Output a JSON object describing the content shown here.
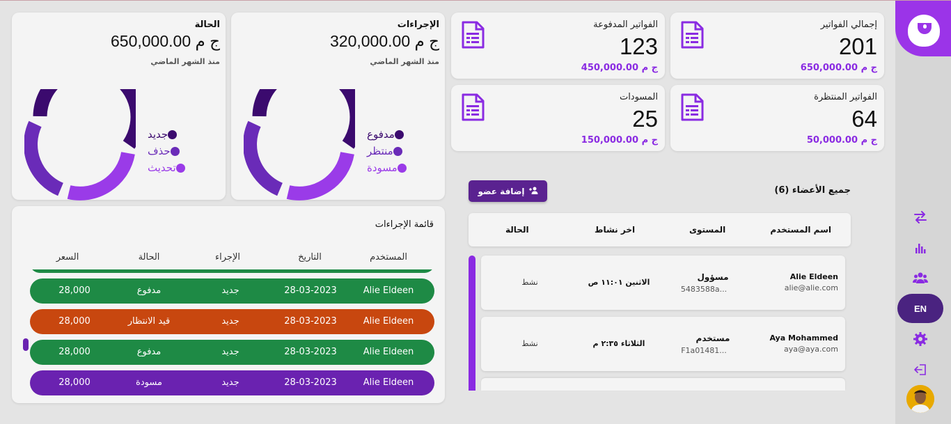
{
  "stats": [
    {
      "title": "إجمالي الفواتير",
      "value": "201",
      "amount": "650,000.00 ج م"
    },
    {
      "title": "الفواتير المدفوعة",
      "value": "123",
      "amount": "450,000.00 ج م"
    },
    {
      "title": "الفواتير المنتظرة",
      "value": "64",
      "amount": "50,000.00 ج م"
    },
    {
      "title": "المسودات",
      "value": "25",
      "amount": "150,000.00 ج م"
    }
  ],
  "actions_summary": {
    "title": "الإجراءات",
    "amount": "320,000.00 ج م",
    "subtitle": "منذ الشهر الماضي",
    "legend": [
      {
        "label": "مدفوع",
        "color": "#3b0a6e"
      },
      {
        "label": "منتظر",
        "color": "#6a2bb8"
      },
      {
        "label": "مسودة",
        "color": "#9a3be8"
      }
    ]
  },
  "status_summary": {
    "title": "الحالة",
    "amount": "650,000.00 ج م",
    "subtitle": "منذ الشهر الماضي",
    "legend": [
      {
        "label": "جديد",
        "color": "#3b0a6e"
      },
      {
        "label": "حذف",
        "color": "#6a2bb8"
      },
      {
        "label": "تحديث",
        "color": "#9a3be8"
      }
    ]
  },
  "actions_list": {
    "title": "قائمة الإجراءات",
    "headers": {
      "user": "المستخدم",
      "date": "التاريخ",
      "action": "الإجراء",
      "status": "الحالة",
      "price": "السعر"
    },
    "rows": [
      {
        "user": "Alie Eldeen",
        "date": "28-03-2023",
        "action": "جديد",
        "status": "مدفوع",
        "price": "28,000",
        "color": "#1e8a45"
      },
      {
        "user": "Alie Eldeen",
        "date": "28-03-2023",
        "action": "جديد",
        "status": "قيد الانتظار",
        "price": "28,000",
        "color": "#c8470f"
      },
      {
        "user": "Alie Eldeen",
        "date": "28-03-2023",
        "action": "جديد",
        "status": "مدفوع",
        "price": "28,000",
        "color": "#1e8a45"
      },
      {
        "user": "Alie Eldeen",
        "date": "28-03-2023",
        "action": "جديد",
        "status": "مسودة",
        "price": "28,000",
        "color": "#6a22b0"
      }
    ]
  },
  "members": {
    "title": "جميع الأعضاء (6)",
    "add_label": "إضافة عضو",
    "headers": {
      "name": "اسم المستخدم",
      "level": "المستوى",
      "activity": "اخر نشاط",
      "status": "الحالة"
    },
    "rows": [
      {
        "name": "Alie Eldeen",
        "email": "alie@alie.com",
        "level": "مسؤول",
        "level_id": "5483588a...",
        "activity": "الاثنين ١١:٠١ ص",
        "status": "نشط"
      },
      {
        "name": "Aya Mohammed",
        "email": "aya@aya.com",
        "level": "مستخدم",
        "level_id": "F1a01481...",
        "activity": "الثلاثاء ٢:٣٥ م",
        "status": "نشط"
      }
    ]
  },
  "sidebar": {
    "lang": "EN",
    "accent": "#8a2be2"
  }
}
